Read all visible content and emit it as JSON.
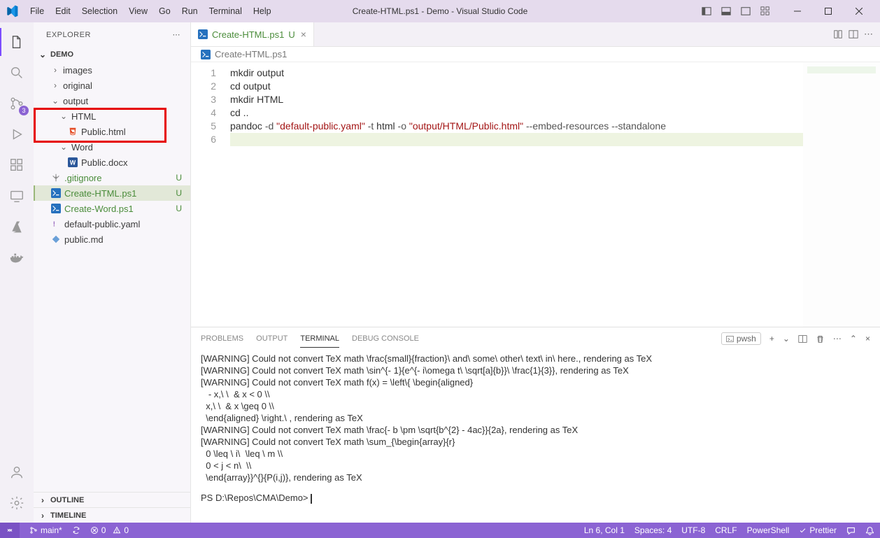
{
  "window": {
    "title": "Create-HTML.ps1 - Demo - Visual Studio Code"
  },
  "menu": [
    "File",
    "Edit",
    "Selection",
    "View",
    "Go",
    "Run",
    "Terminal",
    "Help"
  ],
  "activity": {
    "scm_badge": "3"
  },
  "explorer": {
    "title": "EXPLORER",
    "section": "DEMO",
    "tree": [
      {
        "type": "folder",
        "name": "images",
        "depth": 1,
        "open": false
      },
      {
        "type": "folder",
        "name": "original",
        "depth": 1,
        "open": false
      },
      {
        "type": "folder",
        "name": "output",
        "depth": 1,
        "open": true
      },
      {
        "type": "folder",
        "name": "HTML",
        "depth": 2,
        "open": true
      },
      {
        "type": "file",
        "name": "Public.html",
        "depth": 3,
        "icon": "html"
      },
      {
        "type": "folder",
        "name": "Word",
        "depth": 2,
        "open": true
      },
      {
        "type": "file",
        "name": "Public.docx",
        "depth": 3,
        "icon": "word"
      },
      {
        "type": "file",
        "name": ".gitignore",
        "depth": 1,
        "icon": "git",
        "status": "U"
      },
      {
        "type": "file",
        "name": "Create-HTML.ps1",
        "depth": 1,
        "icon": "ps",
        "status": "U",
        "selected": true
      },
      {
        "type": "file",
        "name": "Create-Word.ps1",
        "depth": 1,
        "icon": "ps",
        "status": "U"
      },
      {
        "type": "file",
        "name": "default-public.yaml",
        "depth": 1,
        "icon": "yaml"
      },
      {
        "type": "file",
        "name": "public.md",
        "depth": 1,
        "icon": "md"
      }
    ],
    "outline": "OUTLINE",
    "timeline": "TIMELINE"
  },
  "tab": {
    "label": "Create-HTML.ps1",
    "status": "U"
  },
  "breadcrumb": "Create-HTML.ps1",
  "code": {
    "lines": [
      [
        {
          "t": "mkdir output",
          "c": ""
        }
      ],
      [
        {
          "t": "cd output",
          "c": ""
        }
      ],
      [
        {
          "t": "mkdir HTML",
          "c": ""
        }
      ],
      [
        {
          "t": "cd ..",
          "c": ""
        }
      ],
      [
        {
          "t": "pandoc ",
          "c": ""
        },
        {
          "t": "-d",
          "c": "op"
        },
        {
          "t": " ",
          "c": ""
        },
        {
          "t": "\"default-public.yaml\"",
          "c": "str"
        },
        {
          "t": " ",
          "c": ""
        },
        {
          "t": "-t",
          "c": "op"
        },
        {
          "t": " html ",
          "c": ""
        },
        {
          "t": "-o",
          "c": "op"
        },
        {
          "t": " ",
          "c": ""
        },
        {
          "t": "\"output/HTML/Public.html\"",
          "c": "str"
        },
        {
          "t": " ",
          "c": ""
        },
        {
          "t": "--embed-resources --standalone",
          "c": "op"
        }
      ],
      [
        {
          "t": "",
          "c": ""
        }
      ]
    ]
  },
  "panel": {
    "tabs": [
      "PROBLEMS",
      "OUTPUT",
      "TERMINAL",
      "DEBUG CONSOLE"
    ],
    "active": "TERMINAL",
    "shell": "pwsh",
    "terminal_lines": [
      "[WARNING] Could not convert TeX math \\frac{small}{fraction}\\ and\\ some\\ other\\ text\\ in\\ here., rendering as TeX",
      "[WARNING] Could not convert TeX math \\sin^{- 1}{e^{- i\\omega t\\ \\sqrt[a]{b}}\\ \\frac{1}{3}}, rendering as TeX",
      "[WARNING] Could not convert TeX math f(x) = \\left\\{ \\begin{aligned}",
      "   - x,\\ \\  & x < 0 \\\\",
      "  x,\\ \\  & x \\geq 0 \\\\",
      "  \\end{aligned} \\right.\\ , rendering as TeX",
      "[WARNING] Could not convert TeX math \\frac{- b \\pm \\sqrt{b^{2} - 4ac}}{2a}, rendering as TeX",
      "[WARNING] Could not convert TeX math \\sum_{\\begin{array}{r}",
      "  0 \\leq \\ i\\  \\leq \\ m \\\\",
      "  0 < j < n\\  \\\\",
      "  \\end{array}}^{}{P(i,j)}, rendering as TeX"
    ],
    "prompt": "PS D:\\Repos\\CMA\\Demo> "
  },
  "status": {
    "branch": "main*",
    "sync": "",
    "errors": "0",
    "warnings": "0",
    "ln_col": "Ln 6, Col 1",
    "spaces": "Spaces: 4",
    "encoding": "UTF-8",
    "eol": "CRLF",
    "lang": "PowerShell",
    "prettier": "Prettier"
  }
}
